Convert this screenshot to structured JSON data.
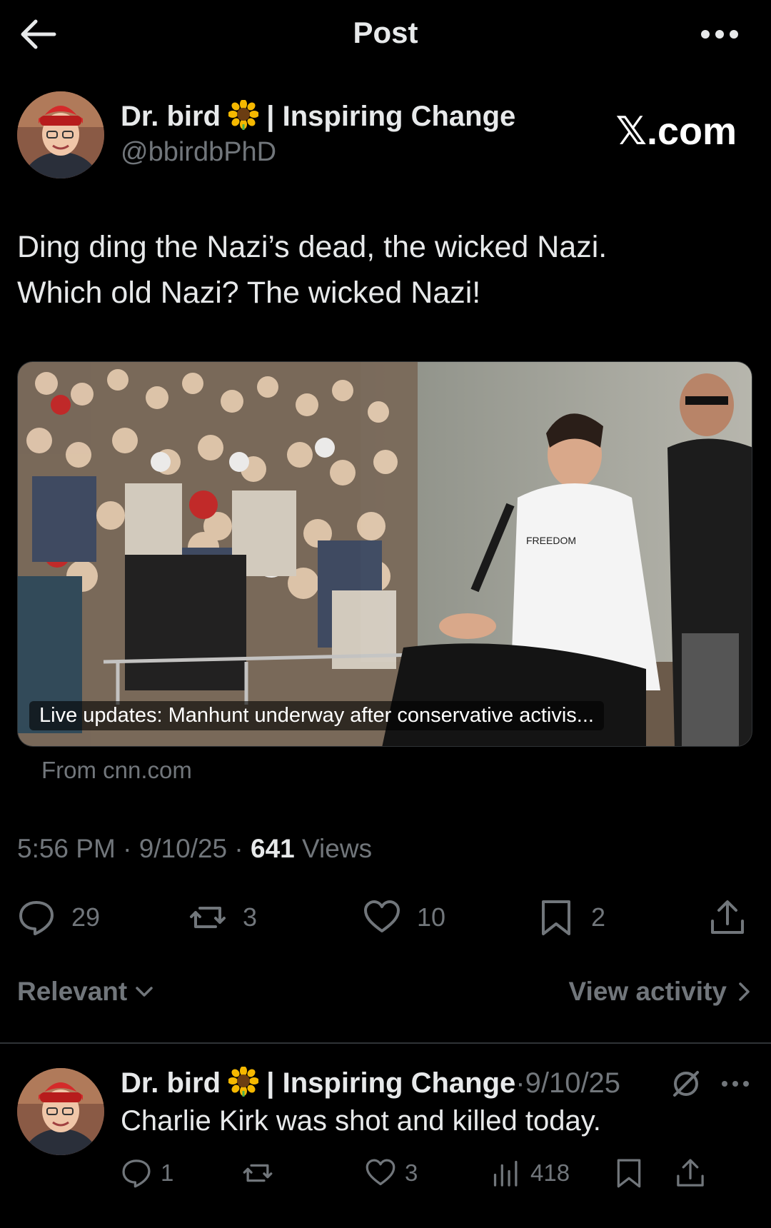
{
  "header": {
    "title": "Post",
    "back_icon": "arrow-left-icon",
    "more_icon": "more-horizontal-icon"
  },
  "watermark": "𝕏.com",
  "post": {
    "author": {
      "name_part1": "Dr. bird",
      "name_emoji": "sunflower-icon",
      "name_part2": "| Inspiring Change",
      "handle": "@bbirdbPhD"
    },
    "text_line1": "Ding ding the Nazi’s dead, the wicked Nazi.",
    "text_line2": "Which old Nazi? The wicked Nazi!",
    "link_card": {
      "caption": "Live updates: Manhunt underway after conservative activis...",
      "source": "From cnn.com",
      "image_shirt_text": "FREEDOM"
    },
    "time": "5:56 PM",
    "date": "9/10/25",
    "separator": "·",
    "views_count": "641",
    "views_label": "Views",
    "stats": {
      "replies": "29",
      "reposts": "3",
      "likes": "10",
      "bookmarks": "2"
    }
  },
  "replies_filter": {
    "sort_label": "Relevant",
    "view_activity_label": "View activity"
  },
  "reply": {
    "name_part1": "Dr. bird",
    "name_part2": "| Inspiring Change",
    "separator": "·",
    "date": "9/10/25",
    "text": "Charlie Kirk was shot and killed today.",
    "stats": {
      "replies": "1",
      "likes": "3",
      "views": "418"
    }
  },
  "colors": {
    "background": "#000000",
    "text_primary": "#e7e9ea",
    "text_secondary": "#71767b",
    "divider": "#2f3336"
  }
}
